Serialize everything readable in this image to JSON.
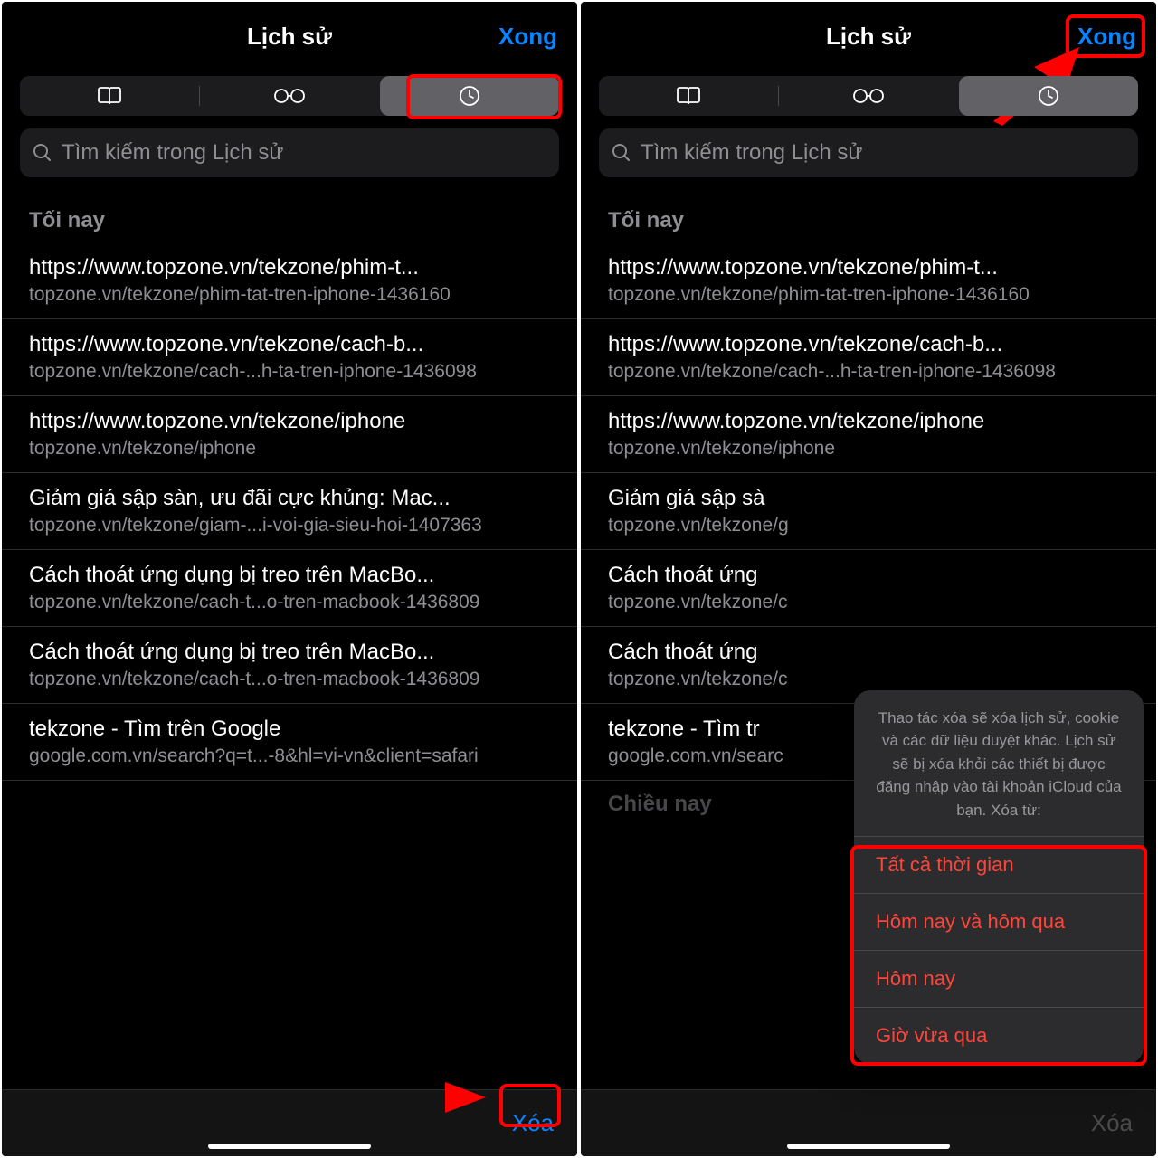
{
  "header": {
    "title": "Lịch sử",
    "done": "Xong"
  },
  "search": {
    "placeholder": "Tìm kiếm trong Lịch sử"
  },
  "section": "Tối nay",
  "left_items": [
    {
      "title": "https://www.topzone.vn/tekzone/phim-t...",
      "url": "topzone.vn/tekzone/phim-tat-tren-iphone-1436160"
    },
    {
      "title": "https://www.topzone.vn/tekzone/cach-b...",
      "url": "topzone.vn/tekzone/cach-...h-ta-tren-iphone-1436098"
    },
    {
      "title": "https://www.topzone.vn/tekzone/iphone",
      "url": "topzone.vn/tekzone/iphone"
    },
    {
      "title": "Giảm giá sập sàn, ưu đãi cực khủng: Mac...",
      "url": "topzone.vn/tekzone/giam-...i-voi-gia-sieu-hoi-1407363"
    },
    {
      "title": "Cách thoát ứng dụng bị treo trên MacBo...",
      "url": "topzone.vn/tekzone/cach-t...o-tren-macbook-1436809"
    },
    {
      "title": "Cách thoát ứng dụng bị treo trên MacBo...",
      "url": "topzone.vn/tekzone/cach-t...o-tren-macbook-1436809"
    },
    {
      "title": "tekzone - Tìm trên Google",
      "url": "google.com.vn/search?q=t...-8&hl=vi-vn&client=safari"
    }
  ],
  "right_items": [
    {
      "title": "https://www.topzone.vn/tekzone/phim-t...",
      "url": "topzone.vn/tekzone/phim-tat-tren-iphone-1436160"
    },
    {
      "title": "https://www.topzone.vn/tekzone/cach-b...",
      "url": "topzone.vn/tekzone/cach-...h-ta-tren-iphone-1436098"
    },
    {
      "title": "https://www.topzone.vn/tekzone/iphone",
      "url": "topzone.vn/tekzone/iphone"
    },
    {
      "title": "Giảm giá sập sà",
      "url": "topzone.vn/tekzone/g"
    },
    {
      "title": "Cách thoát ứng",
      "url": "topzone.vn/tekzone/c"
    },
    {
      "title": "Cách thoát ứng",
      "url": "topzone.vn/tekzone/c"
    },
    {
      "title": "tekzone - Tìm tr",
      "url": "google.com.vn/searc"
    }
  ],
  "section2": "Chiều nay",
  "toolbar": {
    "clear": "Xóa"
  },
  "popover": {
    "message": "Thao tác xóa sẽ xóa lịch sử, cookie và các dữ liệu duyệt khác. Lịch sử sẽ bị xóa khỏi các thiết bị được đăng nhập vào tài khoản iCloud của bạn. Xóa từ:",
    "options": [
      "Tất cả thời gian",
      "Hôm nay và hôm qua",
      "Hôm nay",
      "Giờ vừa qua"
    ]
  }
}
